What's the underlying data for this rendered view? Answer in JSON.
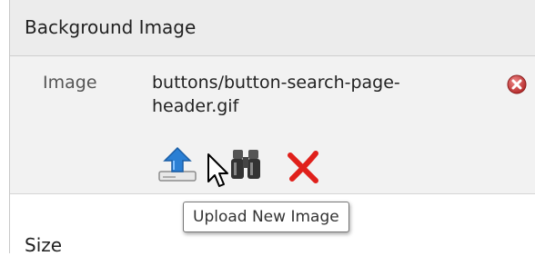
{
  "section": {
    "title": "Background Image"
  },
  "image_field": {
    "label": "Image",
    "file_name": "buttons/button-search-page-header.gif"
  },
  "actions": {
    "remove_icon": "remove-circle-icon",
    "upload_icon": "upload-icon",
    "browse_icon": "binoculars-icon",
    "delete_icon": "red-x-icon"
  },
  "tooltip": {
    "text": "Upload New Image"
  },
  "next_section": {
    "label": "Size"
  },
  "colors": {
    "remove": "#d9534f",
    "delete": "#e0201b",
    "upload_arrow": "#2a7fd4"
  }
}
